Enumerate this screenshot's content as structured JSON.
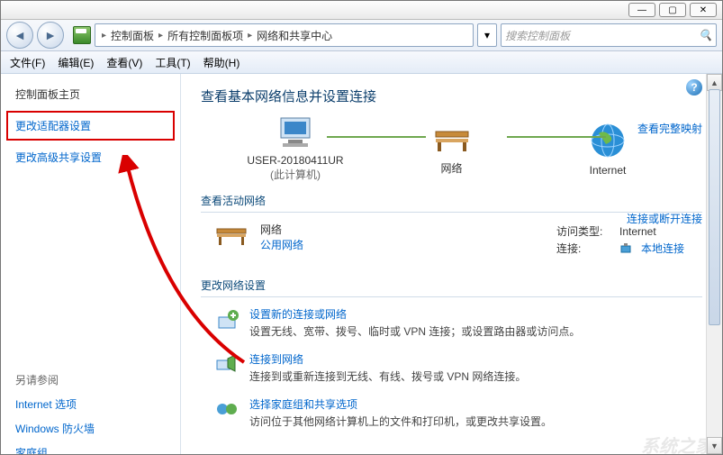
{
  "titlebar": {
    "min": "—",
    "max": "▢",
    "close": "✕"
  },
  "breadcrumb": {
    "p1": "控制面板",
    "p2": "所有控制面板项",
    "p3": "网络和共享中心"
  },
  "search": {
    "placeholder": "搜索控制面板"
  },
  "menu": {
    "file": "文件(F)",
    "edit": "编辑(E)",
    "view": "查看(V)",
    "tools": "工具(T)",
    "help": "帮助(H)"
  },
  "sidebar": {
    "heading": "控制面板主页",
    "adapter": "更改适配器设置",
    "advanced": "更改高级共享设置",
    "see_also": "另请参阅",
    "internet_options": "Internet 选项",
    "firewall": "Windows 防火墙",
    "homegroup": "家庭组"
  },
  "main": {
    "title": "查看基本网络信息并设置连接",
    "map_link": "查看完整映射",
    "node1_label": "USER-20180411UR",
    "node1_sublabel": "(此计算机)",
    "node2_label": "网络",
    "node3_label": "Internet",
    "active_title": "查看活动网络",
    "conn_link": "连接或断开连接",
    "net_name": "网络",
    "net_type": "公用网络",
    "access_k": "访问类型:",
    "access_v": "Internet",
    "conn_k": "连接:",
    "conn_v": "本地连接",
    "settings_title": "更改网络设置",
    "s1_t": "设置新的连接或网络",
    "s1_d": "设置无线、宽带、拨号、临时或 VPN 连接；或设置路由器或访问点。",
    "s2_t": "连接到网络",
    "s2_d": "连接到或重新连接到无线、有线、拨号或 VPN 网络连接。",
    "s3_t": "选择家庭组和共享选项",
    "s3_d": "访问位于其他网络计算机上的文件和打印机，或更改共享设置。"
  },
  "watermark": "系统之家"
}
